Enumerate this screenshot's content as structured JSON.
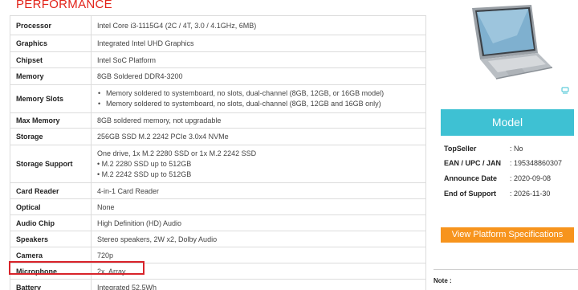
{
  "section": {
    "title": "PERFORMANCE"
  },
  "specs": [
    {
      "label": "Processor",
      "value": "Intel Core i3-1115G4 (2C / 4T, 3.0 / 4.1GHz, 6MB)"
    },
    {
      "label": "Graphics",
      "value": "Integrated Intel UHD Graphics"
    },
    {
      "label": "Chipset",
      "value": "Intel SoC Platform"
    },
    {
      "label": "Memory",
      "value": "8GB Soldered DDR4-3200"
    },
    {
      "label": "Memory Slots",
      "bullets": [
        "Memory soldered to systemboard, no slots, dual-channel (8GB, 12GB, or 16GB model)",
        "Memory soldered to systemboard, no slots, dual-channel (8GB, 12GB and 16GB only)"
      ]
    },
    {
      "label": "Max Memory",
      "value": "8GB soldered memory, not upgradable"
    },
    {
      "label": "Storage",
      "value": "256GB SSD M.2 2242 PCIe 3.0x4 NVMe"
    },
    {
      "label": "Storage Support",
      "lines": [
        "One drive, 1x M.2 2280 SSD or 1x M.2 2242 SSD",
        "• M.2 2280 SSD up to 512GB",
        "• M.2 2242 SSD up to 512GB"
      ]
    },
    {
      "label": "Card Reader",
      "value": "4-in-1 Card Reader"
    },
    {
      "label": "Optical",
      "value": "None"
    },
    {
      "label": "Audio Chip",
      "value": "High Definition (HD) Audio"
    },
    {
      "label": "Speakers",
      "value": "Stereo speakers, 2W x2, Dolby Audio"
    },
    {
      "label": "Camera",
      "value": "720p"
    },
    {
      "label": "Microphone",
      "value": "2x, Array"
    },
    {
      "label": "Battery",
      "value": "Integrated 52.5Wh"
    }
  ],
  "model": {
    "title": "Model",
    "fields": [
      {
        "key": "TopSeller",
        "value": ": No"
      },
      {
        "key": "EAN / UPC / JAN",
        "value": ": 195348860307"
      },
      {
        "key": "Announce Date",
        "value": ": 2020-09-08"
      },
      {
        "key": "End of Support",
        "value": ": 2026-11-30"
      }
    ]
  },
  "platform_button": {
    "label": "View Platform Specifications"
  },
  "note": {
    "label": "Note :"
  },
  "colors": {
    "accent_red": "#e2231a",
    "model_teal": "#3ec1d3",
    "button_orange": "#f7941d",
    "highlight": "#d8232a"
  }
}
